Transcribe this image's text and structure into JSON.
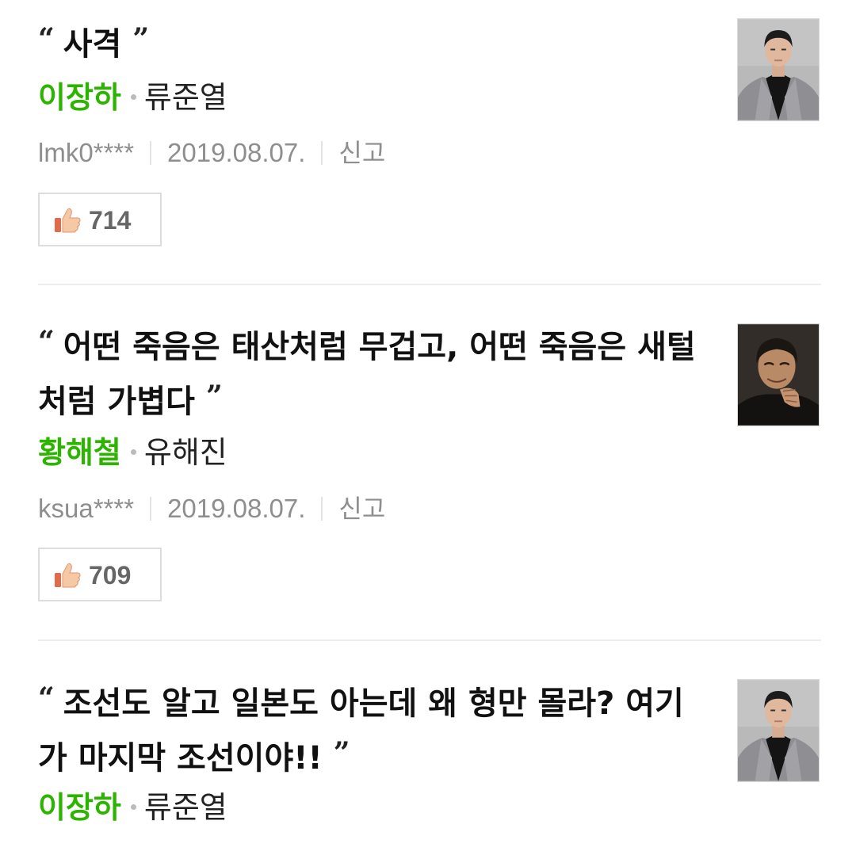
{
  "entries": [
    {
      "quote_open": "“",
      "quote": "사격",
      "quote_close": "”",
      "role": "이장하",
      "actor": "류준열",
      "user": "lmk0****",
      "date": "2019.08.07.",
      "report_label": "신고",
      "likes": "714",
      "like_icon": "thumbs-up-icon",
      "thumb": "actor-photo-ryu-jun-yeol"
    },
    {
      "quote_open": "“",
      "quote": "어떤 죽음은 태산처럼 무겁고, 어떤 죽음은 새털처럼 가볍다",
      "quote_close": "”",
      "role": "황해철",
      "actor": "유해진",
      "user": "ksua****",
      "date": "2019.08.07.",
      "report_label": "신고",
      "likes": "709",
      "like_icon": "thumbs-up-icon",
      "thumb": "actor-photo-yoo-hae-jin"
    },
    {
      "quote_open": "“",
      "quote": "조선도 알고 일본도 아는데 왜 형만 몰라? 여기가 마지막 조선이야!!",
      "quote_close": "”",
      "role": "이장하",
      "actor": "류준열",
      "user": "",
      "date": "",
      "report_label": "",
      "likes": "",
      "like_icon": "thumbs-up-icon",
      "thumb": "actor-photo-ryu-jun-yeol"
    }
  ],
  "colors": {
    "role_green": "#2db400",
    "meta_gray": "#8e8e8e",
    "divider": "#eeeeee"
  }
}
